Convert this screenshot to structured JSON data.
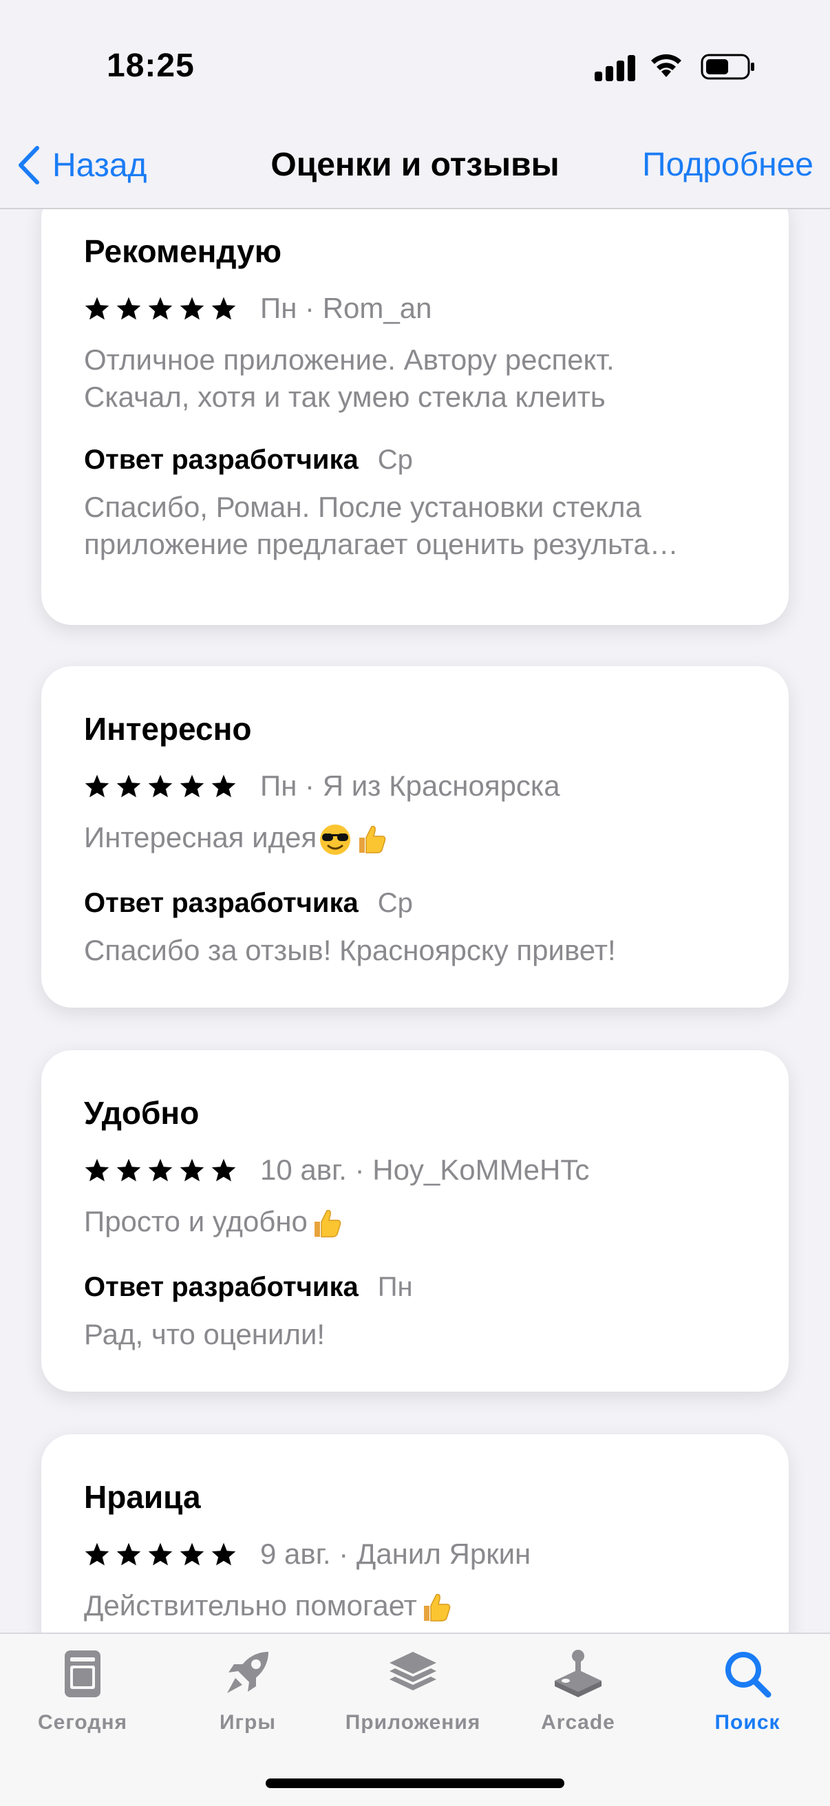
{
  "status_bar": {
    "time": "18:25"
  },
  "nav": {
    "back_label": "Назад",
    "title": "Оценки и отзывы",
    "more_label": "Подробнее"
  },
  "reviews": [
    {
      "title": "Рекомендую",
      "stars": 5,
      "meta": "Пн · Rom_an",
      "text_lines": [
        "Отличное приложение. Автору респект.",
        "Скачал, хотя и так умею стекла клеить"
      ],
      "dev_label": "Ответ разработчика",
      "dev_date": "Ср",
      "dev_lines": [
        "Спасибо, Роман. После установки стекла",
        "приложение предлагает оценить результа…"
      ]
    },
    {
      "title": "Интересно",
      "stars": 5,
      "meta": "Пн · Я из Красноярска",
      "text": "Интересная идея",
      "emojis": [
        "sunglasses-face",
        "thumbs-up"
      ],
      "dev_label": "Ответ разработчика",
      "dev_date": "Ср",
      "dev_text": "Спасибо за отзыв! Красноярску привет!"
    },
    {
      "title": "Удобно",
      "stars": 5,
      "meta": "10 авг. · Hoy_KoMMeHTc",
      "text": "Просто и удобно",
      "emojis": [
        "thumbs-up"
      ],
      "dev_label": "Ответ разработчика",
      "dev_date": "Пн",
      "dev_text": "Рад, что оценили!"
    },
    {
      "title": "Нраица",
      "stars": 5,
      "meta": "9 авг. · Данил Яркин",
      "text": "Действительно помогает",
      "emojis": [
        "thumbs-up"
      ]
    }
  ],
  "tabbar": {
    "tabs": [
      {
        "label": "Сегодня",
        "icon": "today-icon"
      },
      {
        "label": "Игры",
        "icon": "rocket-icon"
      },
      {
        "label": "Приложения",
        "icon": "apps-stack-icon"
      },
      {
        "label": "Arcade",
        "icon": "joystick-icon"
      },
      {
        "label": "Поиск",
        "icon": "search-icon",
        "active": true
      }
    ]
  },
  "colors": {
    "accent": "#1a7cf5",
    "secondary_text": "#8a8a8e",
    "background": "#f2f2f7"
  }
}
